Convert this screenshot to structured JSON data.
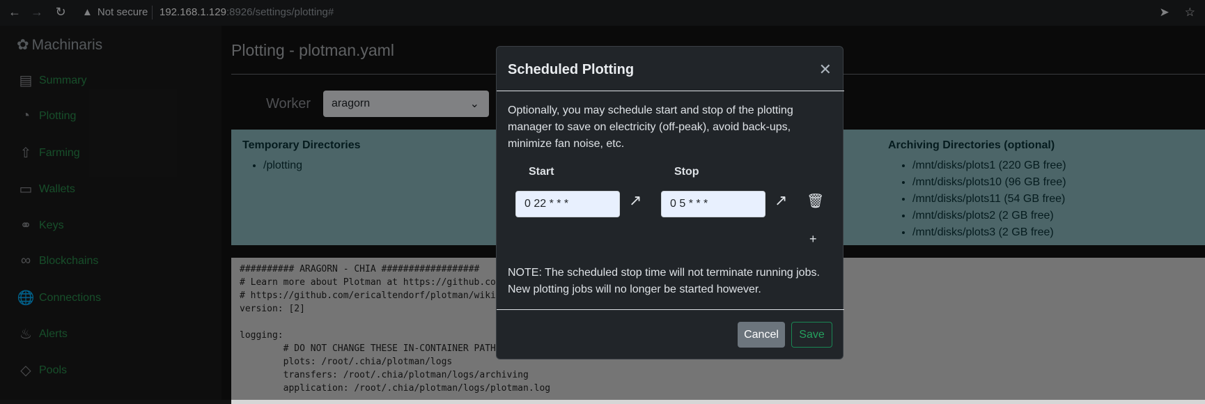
{
  "browser": {
    "security_label": "Not secure",
    "url_host": "192.168.1.129",
    "url_path": ":8926/settings/plotting#"
  },
  "sidebar": {
    "brand": "Machinaris",
    "items": [
      {
        "label": "Summary",
        "icon": "list-icon"
      },
      {
        "label": "Plotting",
        "icon": "gauge-icon"
      },
      {
        "label": "Farming",
        "icon": "tree-icon"
      },
      {
        "label": "Wallets",
        "icon": "wallet-icon"
      },
      {
        "label": "Keys",
        "icon": "key-icon"
      },
      {
        "label": "Blockchains",
        "icon": "link-icon"
      },
      {
        "label": "Connections",
        "icon": "globe-icon"
      },
      {
        "label": "Alerts",
        "icon": "bell-icon"
      },
      {
        "label": "Pools",
        "icon": "diamond-icon"
      }
    ]
  },
  "main": {
    "title": "Plotting - plotman.yaml",
    "worker_label": "Worker",
    "worker_value": "aragorn",
    "temp_dirs_title": "Temporary Directories",
    "temp_dirs": [
      "/plotting"
    ],
    "archive_title": "Archiving Directories (optional)",
    "archive_dirs": [
      "/mnt/disks/plots1 (220 GB free)",
      "/mnt/disks/plots10 (96 GB free)",
      "/mnt/disks/plots11 (54 GB free)",
      "/mnt/disks/plots2 (2 GB free)",
      "/mnt/disks/plots3 (2 GB free)"
    ],
    "config_lines": [
      "########## ARAGORN - CHIA ##################",
      "# Learn more about Plotman at https://github.com",
      "# https://github.com/ericaltendorf/plotman/wiki/",
      "version: [2]",
      "",
      "logging:",
      "        # DO NOT CHANGE THESE IN-CONTAINER PATHS",
      "        plots: /root/.chia/plotman/logs",
      "        transfers: /root/.chia/plotman/logs/archiving",
      "        application: /root/.chia/plotman/logs/plotman.log"
    ]
  },
  "modal": {
    "title": "Scheduled Plotting",
    "description": "Optionally, you may schedule start and stop of the plotting manager to save on electricity (off-peak), avoid back-ups, minimize fan noise, etc.",
    "start_label": "Start",
    "stop_label": "Stop",
    "start_value": "0 22 * * *",
    "stop_value": "0 5 * * *",
    "note": "NOTE: The scheduled stop time will not terminate running jobs. New plotting jobs will no longer be started however.",
    "cancel_label": "Cancel",
    "save_label": "Save"
  }
}
